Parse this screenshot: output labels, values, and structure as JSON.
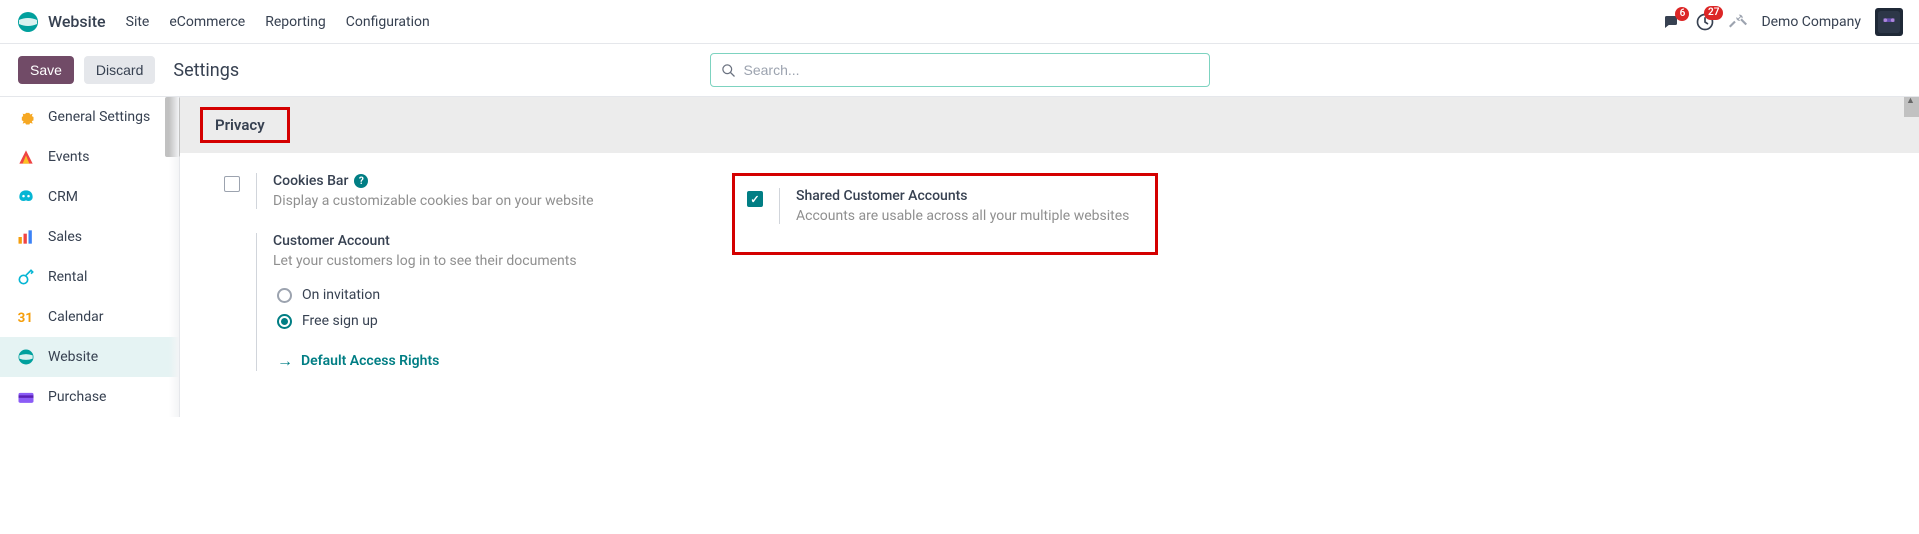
{
  "topbar": {
    "brand": "Website",
    "nav": [
      "Site",
      "eCommerce",
      "Reporting",
      "Configuration"
    ],
    "msg_badge": "6",
    "clock_badge": "27",
    "company": "Demo Company"
  },
  "actionbar": {
    "save": "Save",
    "discard": "Discard",
    "title": "Settings",
    "search_placeholder": "Search..."
  },
  "sidebar": {
    "items": [
      {
        "label": "General Settings"
      },
      {
        "label": "Events"
      },
      {
        "label": "CRM"
      },
      {
        "label": "Sales"
      },
      {
        "label": "Rental"
      },
      {
        "label": "Calendar"
      },
      {
        "label": "Website"
      },
      {
        "label": "Purchase"
      }
    ]
  },
  "section": {
    "title": "Privacy"
  },
  "settings": {
    "cookies": {
      "title": "Cookies Bar",
      "desc": "Display a customizable cookies bar on your website"
    },
    "shared": {
      "title": "Shared Customer Accounts",
      "desc": "Accounts are usable across all your multiple websites"
    },
    "customer_account": {
      "title": "Customer Account",
      "desc": "Let your customers log in to see their documents",
      "radio1": "On invitation",
      "radio2": "Free sign up",
      "link": "Default Access Rights"
    }
  }
}
